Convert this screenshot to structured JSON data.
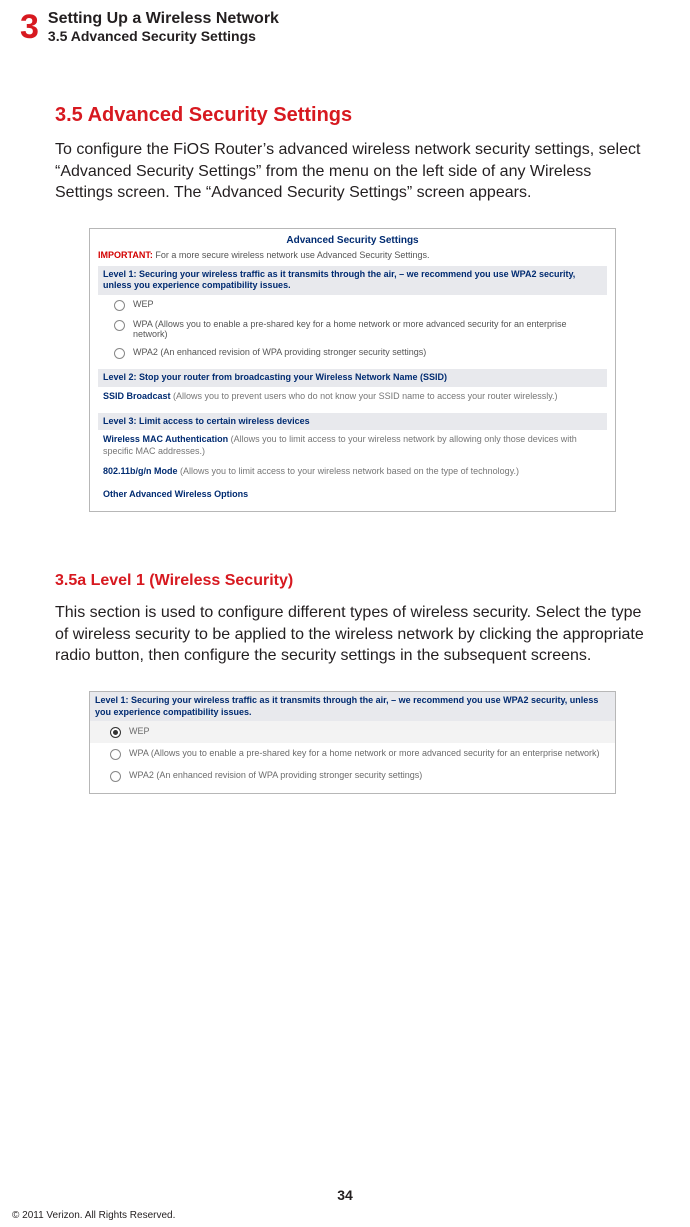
{
  "header": {
    "chapter_num": "3",
    "chapter_title": "Setting Up a Wireless Network",
    "section_crumb": "3.5  Advanced Security Settings"
  },
  "section": {
    "title": "3.5  Advanced Security Settings",
    "intro": "To configure the FiOS Router’s advanced wireless network security settings, select “Advanced Security Settings” from the menu on the left side of any Wireless Settings screen. The “Advanced Security Settings” screen appears."
  },
  "screenshot1": {
    "title": "Advanced Security Settings",
    "important_label": "IMPORTANT:",
    "important_text": " For a more secure wireless network use Advanced Security Settings.",
    "level1_bar": "Level 1: Securing your wireless traffic as it transmits through the air, – we recommend you use WPA2 security, unless you experience compatibility issues.",
    "radio_wep": "WEP",
    "radio_wpa": "WPA (Allows you to enable a pre-shared key for a home network or more advanced security for an enterprise network)",
    "radio_wpa2": "WPA2 (An enhanced revision of WPA providing stronger security settings)",
    "level2_bar": "Level 2: Stop your router from broadcasting your Wireless Network Name (SSID)",
    "ssid_label": "SSID Broadcast",
    "ssid_desc": " (Allows you to prevent users who do not know your SSID name to access your router wirelessly.)",
    "level3_bar": "Level 3: Limit access to certain wireless devices",
    "mac_label": "Wireless MAC Authentication",
    "mac_desc": " (Allows you to limit access to your wireless network by allowing only those devices with specific MAC addresses.)",
    "mode_label": "802.11b/g/n Mode",
    "mode_desc": " (Allows you to limit access to your wireless network based on the type of technology.)",
    "other": "Other Advanced Wireless Options"
  },
  "subsection": {
    "title": "3.5a  Level 1 (Wireless Security)",
    "body": "This section is used to configure different types of wireless security. Select the type of wireless security to be applied to the wireless network by clicking the appropriate radio button, then configure the security settings in the subsequent screens."
  },
  "screenshot2": {
    "level1_bar": "Level 1: Securing your wireless traffic as it transmits through the air, – we recommend you use WPA2 security, unless you experience compatibility issues.",
    "radio_wep": "WEP",
    "radio_wpa": "WPA (Allows you to enable a pre-shared key for a home network or more advanced security for an enterprise network)",
    "radio_wpa2": "WPA2 (An enhanced revision of WPA providing stronger security settings)"
  },
  "footer": {
    "page_number": "34",
    "copyright": "© 2011 Verizon. All Rights Reserved."
  }
}
